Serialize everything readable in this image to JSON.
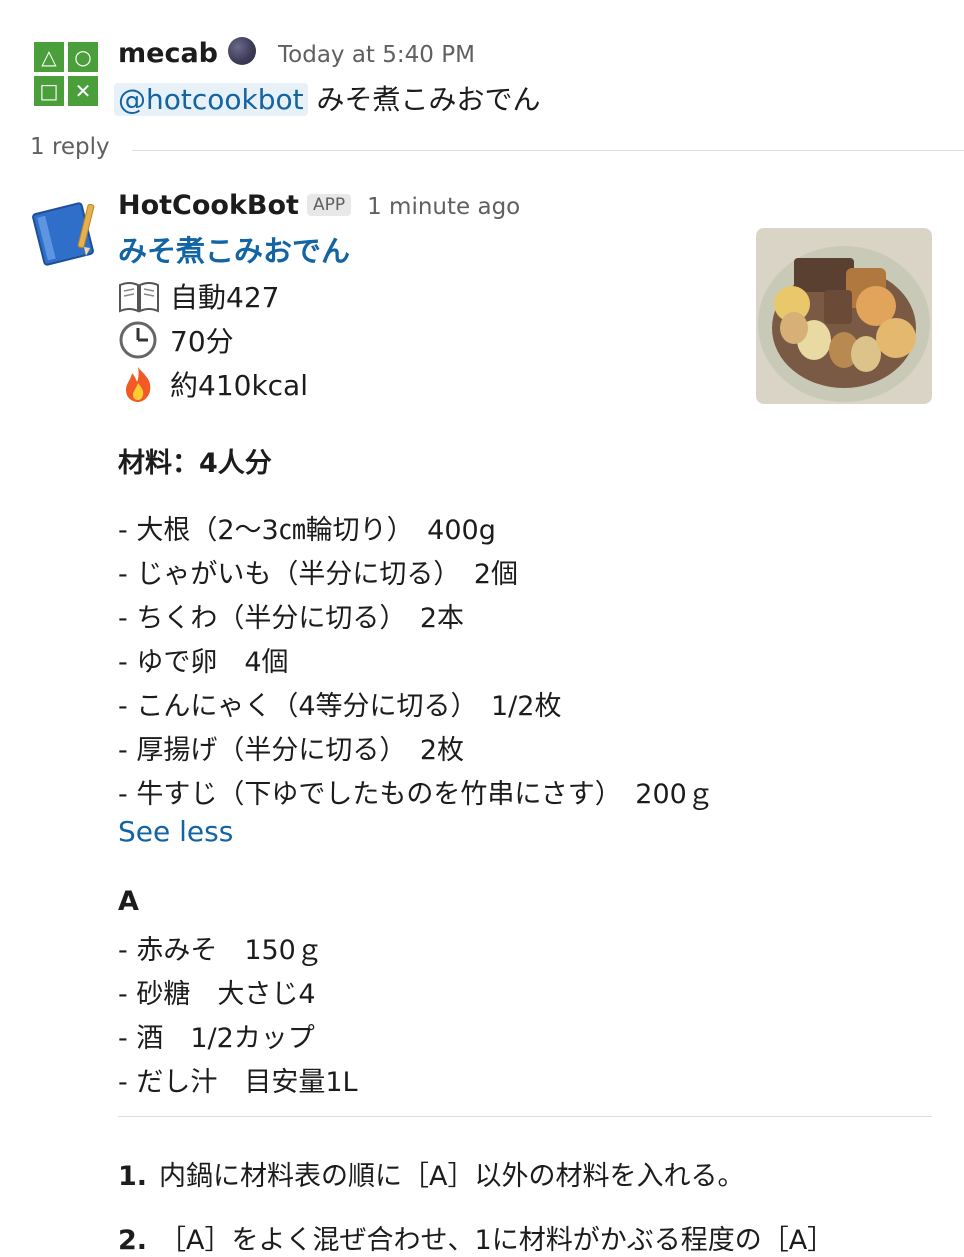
{
  "message": {
    "avatar_glyphs": [
      "△",
      "○",
      "□",
      "✕"
    ],
    "username": "mecab",
    "status_icon": "new-moon-face-icon",
    "timestamp": "Today at 5:40 PM",
    "mention": "@hotcookbot",
    "text": "みそ煮こみおでん"
  },
  "thread": {
    "reply_count": "1 reply"
  },
  "reply": {
    "bot_name": "HotCookBot",
    "badge": "APP",
    "timestamp": "1 minute ago",
    "recipe_title": "みそ煮こみおでん",
    "meta": [
      {
        "icon": "open-book-icon",
        "text": "自動427"
      },
      {
        "icon": "clock-icon",
        "text": "70分"
      },
      {
        "icon": "fire-icon",
        "text": "約410kcal"
      }
    ],
    "ingredients_heading": "材料：4人分",
    "ingredients": [
      "- 大根（2〜3㎝輪切り）　400g",
      "- じゃがいも（半分に切る）　2個",
      "- ちくわ（半分に切る）　2本",
      "- ゆで卵　4個",
      "- こんにゃく（4等分に切る）　1/2枚",
      "- 厚揚げ（半分に切る）　2枚",
      "- 牛すじ（下ゆでしたものを竹串にさす）　200ｇ"
    ],
    "see_less": "See less",
    "group_a_heading": "A",
    "group_a": [
      "- 赤みそ　150ｇ",
      "- 砂糖　大さじ4",
      "- 酒　1/2カップ",
      "- だし汁　目安量1L"
    ],
    "steps": [
      {
        "num": "1.",
        "text": "内鍋に材料表の順に［A］以外の材料を入れる。"
      },
      {
        "num": "2.",
        "text": "［A］をよく混ぜ合わせ、1に材料がかぶる程度の［A］"
      }
    ]
  }
}
